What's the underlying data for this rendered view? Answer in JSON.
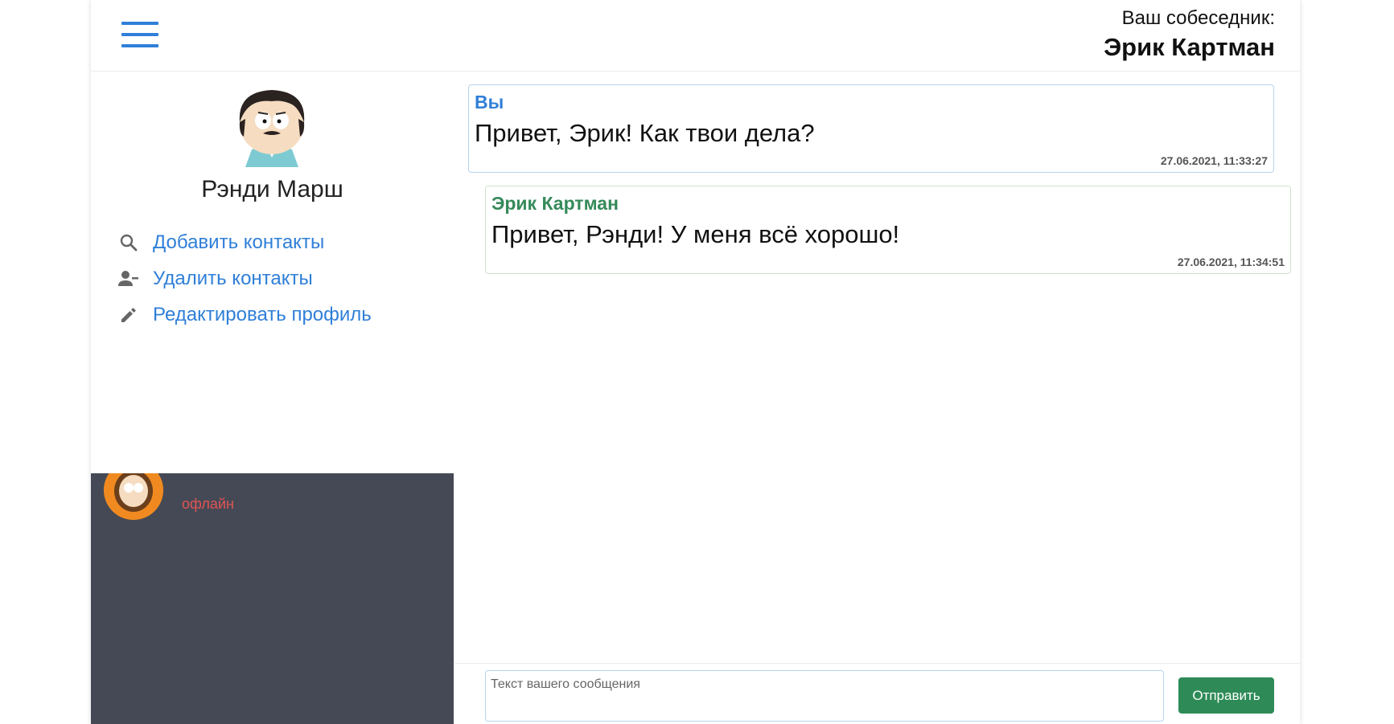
{
  "header": {
    "partner_label": "Ваш собеседник:",
    "partner_name": "Эрик Картман"
  },
  "profile": {
    "name": "Рэнди Марш"
  },
  "nav": [
    {
      "label": "Добавить контакты",
      "icon": "search-icon"
    },
    {
      "label": "Удалить контакты",
      "icon": "person-remove-icon"
    },
    {
      "label": "Редактировать профиль",
      "icon": "pencil-icon"
    }
  ],
  "contacts": [
    {
      "name": "",
      "status": "офлайн"
    }
  ],
  "messages": [
    {
      "author": "Вы",
      "text": "Привет, Эрик! Как твои дела?",
      "time": "27.06.2021, 11:33:27"
    },
    {
      "author": "Эрик Картман",
      "text": "Привет, Рэнди! У меня всё хорошо!",
      "time": "27.06.2021, 11:34:51"
    }
  ],
  "composer": {
    "placeholder": "Текст вашего сообщения",
    "send_label": "Отправить"
  },
  "colors": {
    "accent": "#2f7fd8",
    "send_button": "#2e8b57",
    "contacts_bg": "#454955",
    "offline": "#e05454",
    "partner_author": "#358a5a"
  }
}
